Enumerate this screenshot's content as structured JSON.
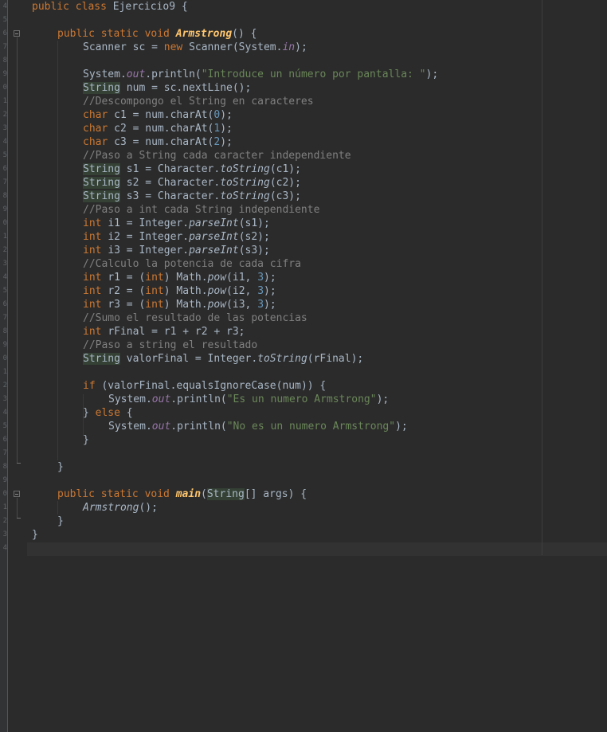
{
  "editor": {
    "line_numbers": [
      "4",
      "5",
      "6",
      "7",
      "8",
      "9",
      "0",
      "1",
      "2",
      "3",
      "4",
      "5",
      "6",
      "7",
      "8",
      "9",
      "0",
      "1",
      "2",
      "3",
      "4",
      "5",
      "6",
      "7",
      "8",
      "9",
      "0",
      "1",
      "2",
      "3",
      "4",
      "5",
      "6",
      "7",
      "8",
      "9",
      "0",
      "1",
      "2",
      "3",
      "4"
    ],
    "lines": [
      {
        "indent": 0,
        "tokens": [
          {
            "c": "kw",
            "t": "public class "
          },
          {
            "c": "pl",
            "t": "Ejercicio9 {"
          }
        ]
      },
      {
        "indent": 0,
        "tokens": []
      },
      {
        "indent": 4,
        "tokens": [
          {
            "c": "kw",
            "t": "public static void "
          },
          {
            "c": "fn",
            "t": "Armstrong"
          },
          {
            "c": "pl",
            "t": "() {"
          }
        ]
      },
      {
        "indent": 8,
        "tokens": [
          {
            "c": "pl",
            "t": "Scanner sc = "
          },
          {
            "c": "kw",
            "t": "new "
          },
          {
            "c": "pl",
            "t": "Scanner(System."
          },
          {
            "c": "fi",
            "t": "in"
          },
          {
            "c": "pl",
            "t": ");"
          }
        ]
      },
      {
        "indent": 0,
        "tokens": []
      },
      {
        "indent": 8,
        "tokens": [
          {
            "c": "pl",
            "t": "System."
          },
          {
            "c": "fi",
            "t": "out"
          },
          {
            "c": "pl",
            "t": ".println("
          },
          {
            "c": "st",
            "t": "\"Introduce un número por pantalla: \""
          },
          {
            "c": "pl",
            "t": ");"
          }
        ]
      },
      {
        "indent": 8,
        "tokens": [
          {
            "c": "hl",
            "t": "String"
          },
          {
            "c": "pl",
            "t": " num = sc.nextLine();"
          }
        ]
      },
      {
        "indent": 8,
        "tokens": [
          {
            "c": "co",
            "t": "//Descompongo el String en caracteres"
          }
        ]
      },
      {
        "indent": 8,
        "tokens": [
          {
            "c": "kw",
            "t": "char "
          },
          {
            "c": "pl",
            "t": "c1 = num.charAt("
          },
          {
            "c": "nu",
            "t": "0"
          },
          {
            "c": "pl",
            "t": ");"
          }
        ]
      },
      {
        "indent": 8,
        "tokens": [
          {
            "c": "kw",
            "t": "char "
          },
          {
            "c": "pl",
            "t": "c2 = num.charAt("
          },
          {
            "c": "nu",
            "t": "1"
          },
          {
            "c": "pl",
            "t": ");"
          }
        ]
      },
      {
        "indent": 8,
        "tokens": [
          {
            "c": "kw",
            "t": "char "
          },
          {
            "c": "pl",
            "t": "c3 = num.charAt("
          },
          {
            "c": "nu",
            "t": "2"
          },
          {
            "c": "pl",
            "t": ");"
          }
        ]
      },
      {
        "indent": 8,
        "tokens": [
          {
            "c": "co",
            "t": "//Paso a String cada caracter independiente"
          }
        ]
      },
      {
        "indent": 8,
        "tokens": [
          {
            "c": "hl",
            "t": "String"
          },
          {
            "c": "pl",
            "t": " s1 = Character."
          },
          {
            "c": "it",
            "t": "toString"
          },
          {
            "c": "pl",
            "t": "(c1);"
          }
        ]
      },
      {
        "indent": 8,
        "tokens": [
          {
            "c": "hl",
            "t": "String"
          },
          {
            "c": "pl",
            "t": " s2 = Character."
          },
          {
            "c": "it",
            "t": "toString"
          },
          {
            "c": "pl",
            "t": "(c2);"
          }
        ]
      },
      {
        "indent": 8,
        "tokens": [
          {
            "c": "hl",
            "t": "String"
          },
          {
            "c": "pl",
            "t": " s3 = Character."
          },
          {
            "c": "it",
            "t": "toString"
          },
          {
            "c": "pl",
            "t": "(c3);"
          }
        ]
      },
      {
        "indent": 8,
        "tokens": [
          {
            "c": "co",
            "t": "//Paso a int cada String independiente"
          }
        ]
      },
      {
        "indent": 8,
        "tokens": [
          {
            "c": "kw",
            "t": "int "
          },
          {
            "c": "pl",
            "t": "i1 = Integer."
          },
          {
            "c": "it",
            "t": "parseInt"
          },
          {
            "c": "pl",
            "t": "(s1);"
          }
        ]
      },
      {
        "indent": 8,
        "tokens": [
          {
            "c": "kw",
            "t": "int "
          },
          {
            "c": "pl",
            "t": "i2 = Integer."
          },
          {
            "c": "it",
            "t": "parseInt"
          },
          {
            "c": "pl",
            "t": "(s2);"
          }
        ]
      },
      {
        "indent": 8,
        "tokens": [
          {
            "c": "kw",
            "t": "int "
          },
          {
            "c": "pl",
            "t": "i3 = Integer."
          },
          {
            "c": "it",
            "t": "parseInt"
          },
          {
            "c": "pl",
            "t": "(s3);"
          }
        ]
      },
      {
        "indent": 8,
        "tokens": [
          {
            "c": "co",
            "t": "//Calculo la potencia de cada cifra"
          }
        ]
      },
      {
        "indent": 8,
        "tokens": [
          {
            "c": "kw",
            "t": "int "
          },
          {
            "c": "pl",
            "t": "r1 = ("
          },
          {
            "c": "kw",
            "t": "int"
          },
          {
            "c": "pl",
            "t": ") Math."
          },
          {
            "c": "it",
            "t": "pow"
          },
          {
            "c": "pl",
            "t": "(i1, "
          },
          {
            "c": "nu",
            "t": "3"
          },
          {
            "c": "pl",
            "t": ");"
          }
        ]
      },
      {
        "indent": 8,
        "tokens": [
          {
            "c": "kw",
            "t": "int "
          },
          {
            "c": "pl",
            "t": "r2 = ("
          },
          {
            "c": "kw",
            "t": "int"
          },
          {
            "c": "pl",
            "t": ") Math."
          },
          {
            "c": "it",
            "t": "pow"
          },
          {
            "c": "pl",
            "t": "(i2, "
          },
          {
            "c": "nu",
            "t": "3"
          },
          {
            "c": "pl",
            "t": ");"
          }
        ]
      },
      {
        "indent": 8,
        "tokens": [
          {
            "c": "kw",
            "t": "int "
          },
          {
            "c": "pl",
            "t": "r3 = ("
          },
          {
            "c": "kw",
            "t": "int"
          },
          {
            "c": "pl",
            "t": ") Math."
          },
          {
            "c": "it",
            "t": "pow"
          },
          {
            "c": "pl",
            "t": "(i3, "
          },
          {
            "c": "nu",
            "t": "3"
          },
          {
            "c": "pl",
            "t": ");"
          }
        ]
      },
      {
        "indent": 8,
        "tokens": [
          {
            "c": "co",
            "t": "//Sumo el resultado de las potencias"
          }
        ]
      },
      {
        "indent": 8,
        "tokens": [
          {
            "c": "kw",
            "t": "int "
          },
          {
            "c": "pl",
            "t": "rFinal = r1 + r2 + r3;"
          }
        ]
      },
      {
        "indent": 8,
        "tokens": [
          {
            "c": "co",
            "t": "//Paso a string el resultado"
          }
        ]
      },
      {
        "indent": 8,
        "tokens": [
          {
            "c": "hl",
            "t": "String"
          },
          {
            "c": "pl",
            "t": " valorFinal = Integer."
          },
          {
            "c": "it",
            "t": "toString"
          },
          {
            "c": "pl",
            "t": "(rFinal);"
          }
        ]
      },
      {
        "indent": 0,
        "tokens": []
      },
      {
        "indent": 8,
        "tokens": [
          {
            "c": "kw",
            "t": "if "
          },
          {
            "c": "pl",
            "t": "(valorFinal.equalsIgnoreCase(num)) {"
          }
        ]
      },
      {
        "indent": 12,
        "tokens": [
          {
            "c": "pl",
            "t": "System."
          },
          {
            "c": "fi",
            "t": "out"
          },
          {
            "c": "pl",
            "t": ".println("
          },
          {
            "c": "st",
            "t": "\"Es un numero Armstrong\""
          },
          {
            "c": "pl",
            "t": ");"
          }
        ]
      },
      {
        "indent": 8,
        "tokens": [
          {
            "c": "pl",
            "t": "} "
          },
          {
            "c": "kw",
            "t": "else "
          },
          {
            "c": "pl",
            "t": "{"
          }
        ]
      },
      {
        "indent": 12,
        "tokens": [
          {
            "c": "pl",
            "t": "System."
          },
          {
            "c": "fi",
            "t": "out"
          },
          {
            "c": "pl",
            "t": ".println("
          },
          {
            "c": "st",
            "t": "\"No es un numero Armstrong\""
          },
          {
            "c": "pl",
            "t": ");"
          }
        ]
      },
      {
        "indent": 8,
        "tokens": [
          {
            "c": "pl",
            "t": "}"
          }
        ]
      },
      {
        "indent": 0,
        "tokens": []
      },
      {
        "indent": 4,
        "tokens": [
          {
            "c": "pl",
            "t": "}"
          }
        ]
      },
      {
        "indent": 0,
        "tokens": []
      },
      {
        "indent": 4,
        "tokens": [
          {
            "c": "kw",
            "t": "public static void "
          },
          {
            "c": "fn",
            "t": "main"
          },
          {
            "c": "pl",
            "t": "("
          },
          {
            "c": "hl",
            "t": "String"
          },
          {
            "c": "pl",
            "t": "[] args) {"
          }
        ]
      },
      {
        "indent": 8,
        "tokens": [
          {
            "c": "it",
            "t": "Armstrong"
          },
          {
            "c": "pl",
            "t": "();"
          }
        ]
      },
      {
        "indent": 4,
        "tokens": [
          {
            "c": "pl",
            "t": "}"
          }
        ]
      },
      {
        "indent": 0,
        "tokens": [
          {
            "c": "pl",
            "t": "}"
          }
        ]
      },
      {
        "indent": 0,
        "tokens": []
      }
    ],
    "colors": {
      "background": "#2b2b2b",
      "keyword": "#cc7832",
      "method_declaration": "#ffc66d",
      "string": "#6a8759",
      "number": "#6897bb",
      "comment": "#808080",
      "static_field": "#9876aa",
      "text": "#a9b7c6"
    }
  }
}
